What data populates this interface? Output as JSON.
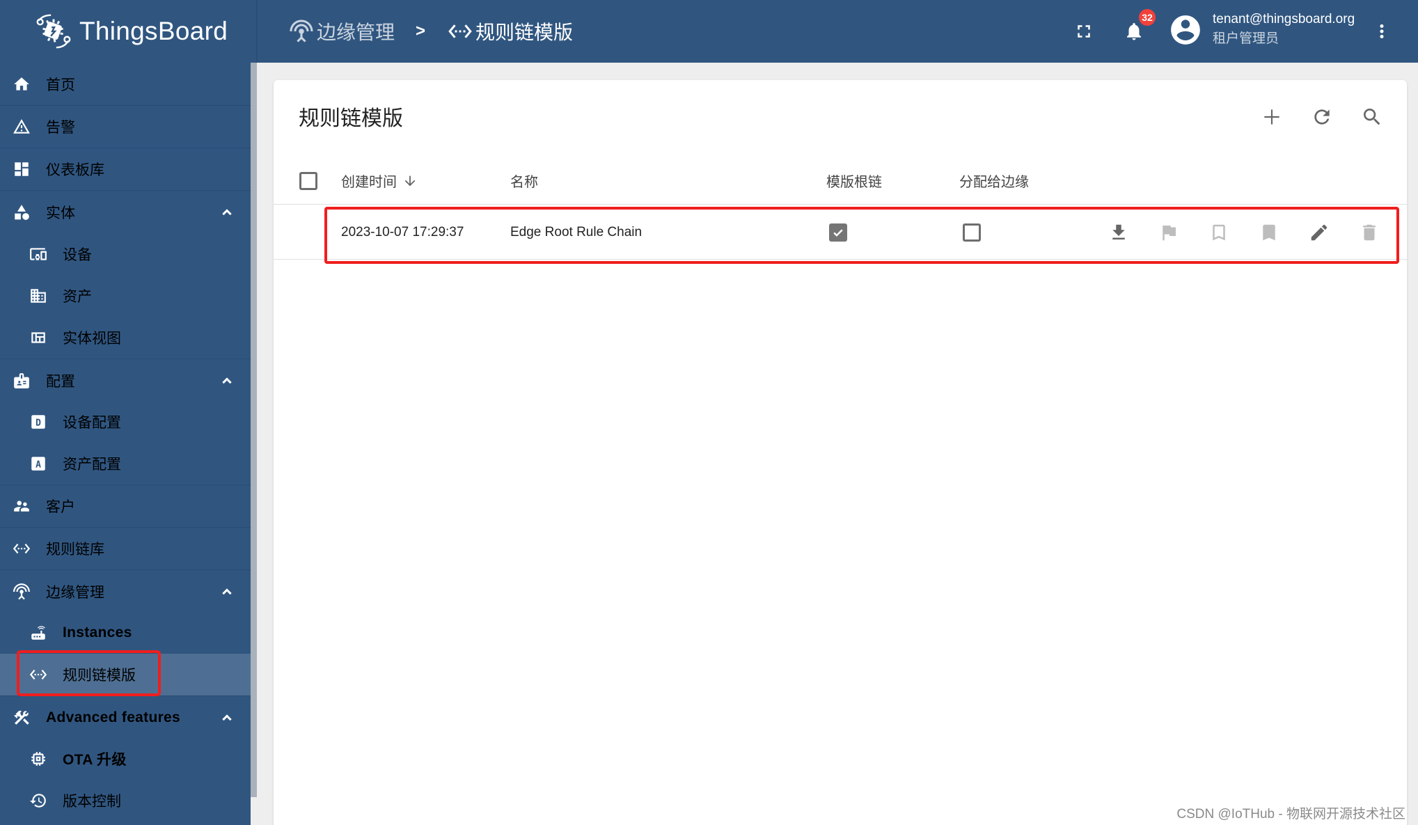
{
  "app": {
    "name": "ThingsBoard"
  },
  "breadcrumb": [
    {
      "label": "边缘管理",
      "icon": "edge-icon"
    },
    {
      "label": "规则链模版",
      "icon": "rule-chain-icon"
    }
  ],
  "breadcrumb_separator": ">",
  "header": {
    "fullscreen_icon": "fullscreen-icon",
    "notifications_count": "32",
    "user_email": "tenant@thingsboard.org",
    "user_role": "租户管理员",
    "more_icon": "more-vert-icon"
  },
  "sidebar": {
    "items": [
      {
        "label": "首页",
        "icon": "home-icon"
      },
      {
        "label": "告警",
        "icon": "warning-icon"
      },
      {
        "label": "仪表板库",
        "icon": "dashboard-icon"
      },
      {
        "label": "实体",
        "icon": "category-icon",
        "expanded": true
      },
      {
        "label": "设备",
        "icon": "devices-icon"
      },
      {
        "label": "资产",
        "icon": "domain-icon"
      },
      {
        "label": "实体视图",
        "icon": "view-quilt-icon"
      },
      {
        "label": "配置",
        "icon": "badge-icon",
        "expanded": true
      },
      {
        "label": "设备配置",
        "icon": "device-profile-icon"
      },
      {
        "label": "资产配置",
        "icon": "asset-profile-icon"
      },
      {
        "label": "客户",
        "icon": "supervisor-account-icon"
      },
      {
        "label": "规则链库",
        "icon": "settings-ethernet-icon"
      },
      {
        "label": "边缘管理",
        "icon": "edge-icon",
        "expanded": true
      },
      {
        "label": "Instances",
        "icon": "router-icon"
      },
      {
        "label": "规则链模版",
        "icon": "settings-ethernet-icon",
        "selected": true
      },
      {
        "label": "Advanced features",
        "icon": "construction-icon",
        "expanded": true
      },
      {
        "label": "OTA 升级",
        "icon": "memory-icon"
      },
      {
        "label": "版本控制",
        "icon": "history-icon"
      }
    ]
  },
  "main": {
    "title": "规则链模版",
    "actions": [
      "add",
      "refresh",
      "search"
    ],
    "table": {
      "columns": [
        {
          "label": "创建时间",
          "sort": "desc"
        },
        {
          "label": "名称"
        },
        {
          "label": "模版根链"
        },
        {
          "label": "分配给边缘"
        }
      ],
      "rows": [
        {
          "created_time": "2023-10-07 17:29:37",
          "name": "Edge Root Rule Chain",
          "template_root": true,
          "assigned_to_edge": false,
          "actions": [
            "export",
            "set-root",
            "set-default-edge",
            "set-auto-assign",
            "edit",
            "delete"
          ]
        }
      ]
    }
  },
  "watermark": "CSDN @IoTHub - 物联网开源技术社区",
  "colors": {
    "primary": "#305680",
    "selected": "#4e6f93",
    "badge": "#f2413a",
    "highlight_box": "#f01e1e"
  }
}
